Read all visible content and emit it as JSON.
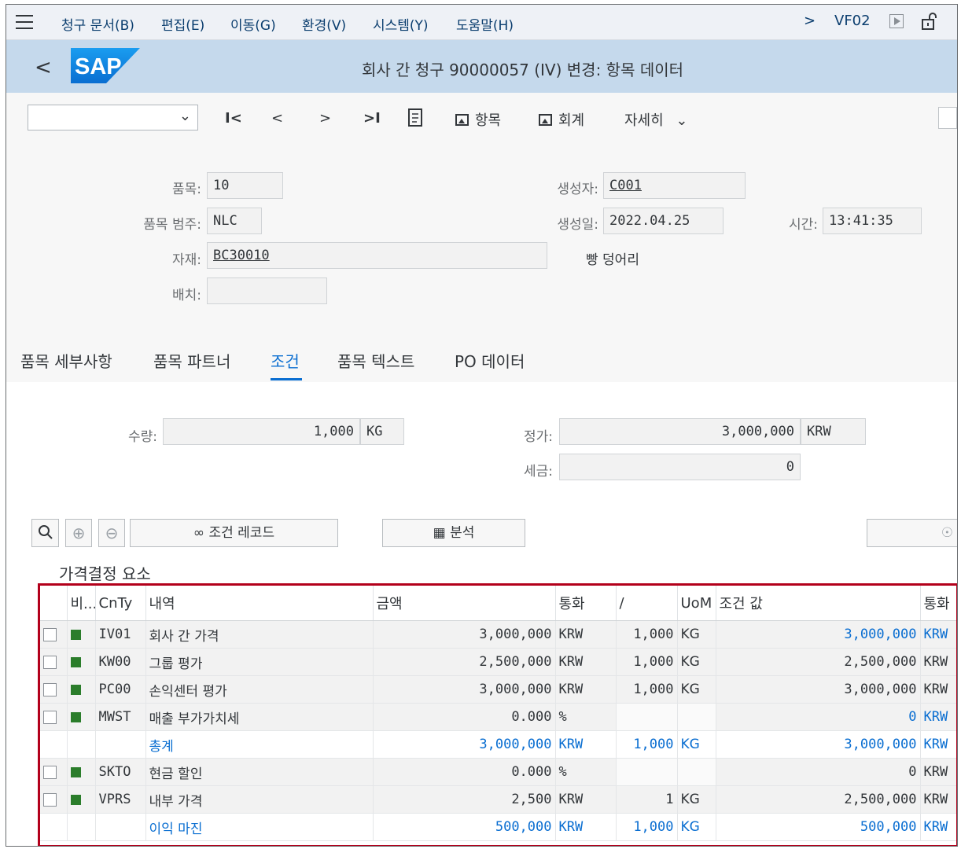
{
  "menubar": {
    "items": [
      "청구 문서(B)",
      "편집(E)",
      "이동(G)",
      "환경(V)",
      "시스템(Y)",
      "도움말(H)"
    ],
    "more": ">",
    "tcode": "VF02"
  },
  "titlebar": {
    "back": "<",
    "logo": "SAP",
    "title": "회사 간 청구 90000057   (IV) 변경: 항목 데이터"
  },
  "toolbar": {
    "first": "I<",
    "prev": "<",
    "next": ">",
    "last": ">I",
    "items_label": "항목",
    "accounting_label": "회계",
    "more_label": "자세히"
  },
  "header": {
    "item": {
      "label": "품목:",
      "value": "10"
    },
    "category": {
      "label": "품목 범주:",
      "value": "NLC"
    },
    "material": {
      "label": "자재:",
      "value": "BC30010",
      "desc": "빵 덩어리"
    },
    "batch": {
      "label": "배치:",
      "value": ""
    },
    "created_by": {
      "label": "생성자:",
      "value": "C001"
    },
    "created_on": {
      "label": "생성일:",
      "value": "2022.04.25"
    },
    "time": {
      "label": "시간:",
      "value": "13:41:35"
    }
  },
  "tabs": [
    "품목 세부사항",
    "품목 파트너",
    "조건",
    "품목 텍스트",
    "PO 데이터"
  ],
  "conditions": {
    "qty_label": "수량:",
    "qty_value": "1,000",
    "qty_unit": "KG",
    "net_label": "정가:",
    "net_value": "3,000,000",
    "net_currency": "KRW",
    "tax_label": "세금:",
    "tax_value": "0",
    "cond_record_label": "조건 레코드",
    "analysis_label": "분석",
    "pricing_title": "가격결정 요소"
  },
  "table": {
    "headers": [
      "",
      "비...",
      "CnTy",
      "내역",
      "금액",
      "통화",
      "/",
      "UoM",
      "조건 값",
      "통화"
    ],
    "rows": [
      {
        "cnty": "IV01",
        "desc": "회사 간 가격",
        "amount": "3,000,000",
        "curr": "KRW",
        "per": "1,000",
        "uom": "KG",
        "value": "3,000,000",
        "vcurr": "KRW"
      },
      {
        "cnty": "KW00",
        "desc": "그룹 평가",
        "amount": "2,500,000",
        "curr": "KRW",
        "per": "1,000",
        "uom": "KG",
        "value": "2,500,000",
        "vcurr": "KRW"
      },
      {
        "cnty": "PC00",
        "desc": "손익센터 평가",
        "amount": "3,000,000",
        "curr": "KRW",
        "per": "1,000",
        "uom": "KG",
        "value": "3,000,000",
        "vcurr": "KRW"
      },
      {
        "cnty": "MWST",
        "desc": "매출 부가가치세",
        "amount": "0.000",
        "curr": "%",
        "per": "",
        "uom": "",
        "value": "0",
        "vcurr": "KRW"
      },
      {
        "cnty": "",
        "desc": "총계",
        "amount": "3,000,000",
        "curr": "KRW",
        "per": "1,000",
        "uom": "KG",
        "value": "3,000,000",
        "vcurr": "KRW"
      },
      {
        "cnty": "SKTO",
        "desc": "현금 할인",
        "amount": "0.000",
        "curr": "%",
        "per": "",
        "uom": "",
        "value": "0",
        "vcurr": "KRW"
      },
      {
        "cnty": "VPRS",
        "desc": "내부 가격",
        "amount": "2,500",
        "curr": "KRW",
        "per": "1",
        "uom": "KG",
        "value": "2,500,000",
        "vcurr": "KRW"
      },
      {
        "cnty": "",
        "desc": "이익 마진",
        "amount": "500,000",
        "curr": "KRW",
        "per": "1,000",
        "uom": "KG",
        "value": "500,000",
        "vcurr": "KRW"
      }
    ]
  },
  "colors": {
    "accent": "#0a6ed1",
    "titlebar": "#c5d9ec",
    "highlight_border": "#b3001b",
    "status_green": "#2b7d2b"
  }
}
